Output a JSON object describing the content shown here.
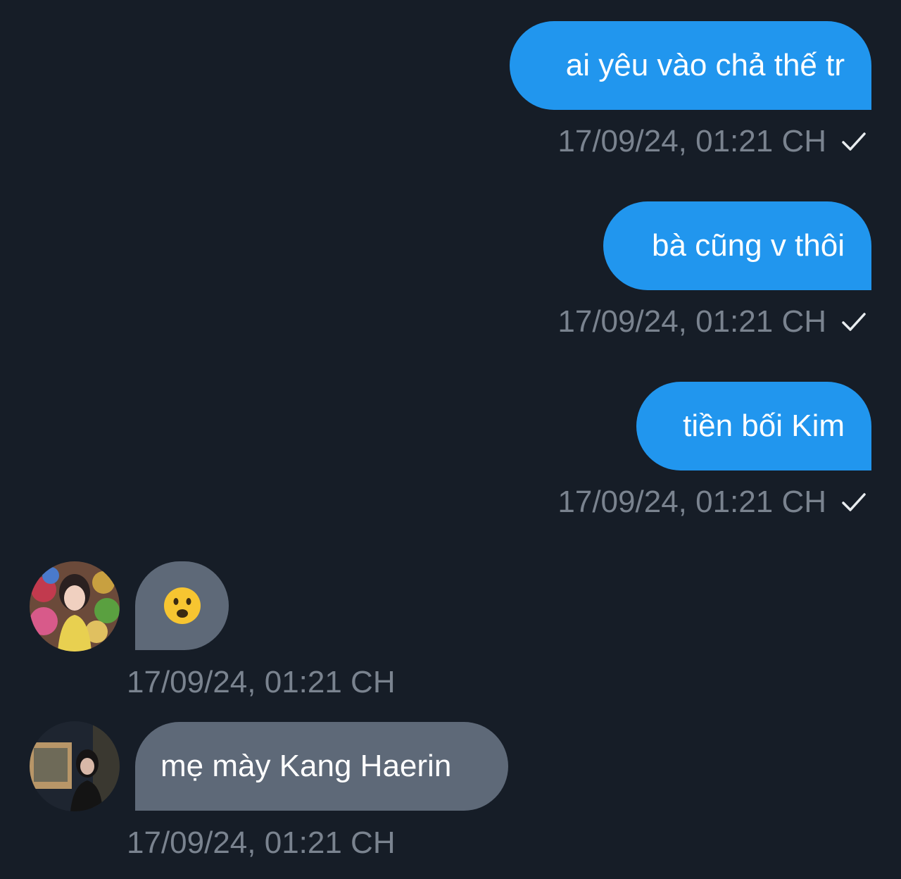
{
  "messages": [
    {
      "direction": "outgoing",
      "text": "ai yêu vào chả thế tr",
      "time": "17/09/24, 01:21 CH",
      "status_icon": "check-icon"
    },
    {
      "direction": "outgoing",
      "text": "bà cũng v thôi",
      "time": "17/09/24, 01:21 CH",
      "status_icon": "check-icon"
    },
    {
      "direction": "outgoing",
      "text": "tiền bối Kim",
      "time": "17/09/24, 01:21 CH",
      "status_icon": "check-icon"
    },
    {
      "direction": "incoming",
      "emoji": "frowning-face-with-open-mouth",
      "time": "17/09/24, 01:21 CH",
      "avatar": "avatar-photo-1"
    },
    {
      "direction": "incoming",
      "text": "mẹ mày Kang Haerin",
      "time": "17/09/24, 01:21 CH",
      "avatar": "avatar-photo-2"
    }
  ],
  "colors": {
    "background": "#161d27",
    "outgoing_bubble": "#2196ee",
    "incoming_bubble": "#5e6978",
    "timestamp": "#7a838f"
  }
}
